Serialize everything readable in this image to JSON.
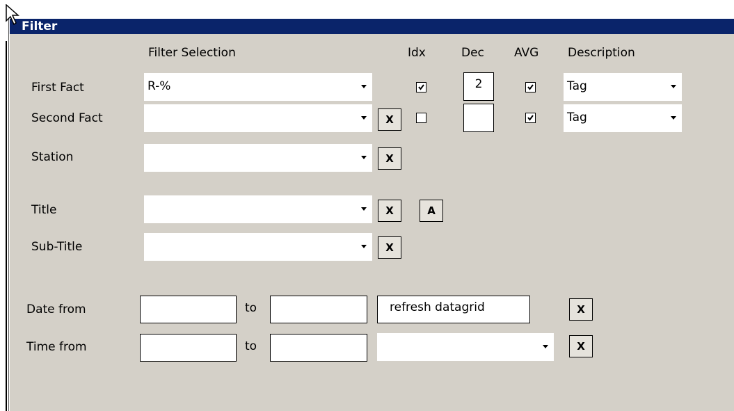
{
  "window": {
    "title": "Filter"
  },
  "headers": {
    "filter_selection": "Filter Selection",
    "idx": "Idx",
    "dec": "Dec",
    "avg": "AVG",
    "description": "Description"
  },
  "rows": {
    "first_fact": {
      "label": "First Fact",
      "value": "R-%",
      "idx_checked": true,
      "dec": "2",
      "avg_checked": true,
      "description": "Tag"
    },
    "second_fact": {
      "label": "Second Fact",
      "value": "",
      "clear": "X",
      "idx_checked": false,
      "dec": "",
      "avg_checked": true,
      "description": "Tag"
    },
    "station": {
      "label": "Station",
      "value": "",
      "clear": "X"
    },
    "title": {
      "label": "Title",
      "value": "",
      "clear": "X",
      "extra": "A"
    },
    "sub_title": {
      "label": "Sub-Title",
      "value": "",
      "clear": "X"
    }
  },
  "date": {
    "label": "Date from",
    "from": "",
    "to_label": "to",
    "to": "",
    "refresh_label": "refresh datagrid",
    "clear": "X"
  },
  "time": {
    "label": "Time from",
    "from": "",
    "to_label": "to",
    "to": "",
    "select_value": "",
    "clear": "X"
  },
  "colors": {
    "titlebar": "#0a246a",
    "panel": "#d4d0c8",
    "field": "#ffffff"
  }
}
